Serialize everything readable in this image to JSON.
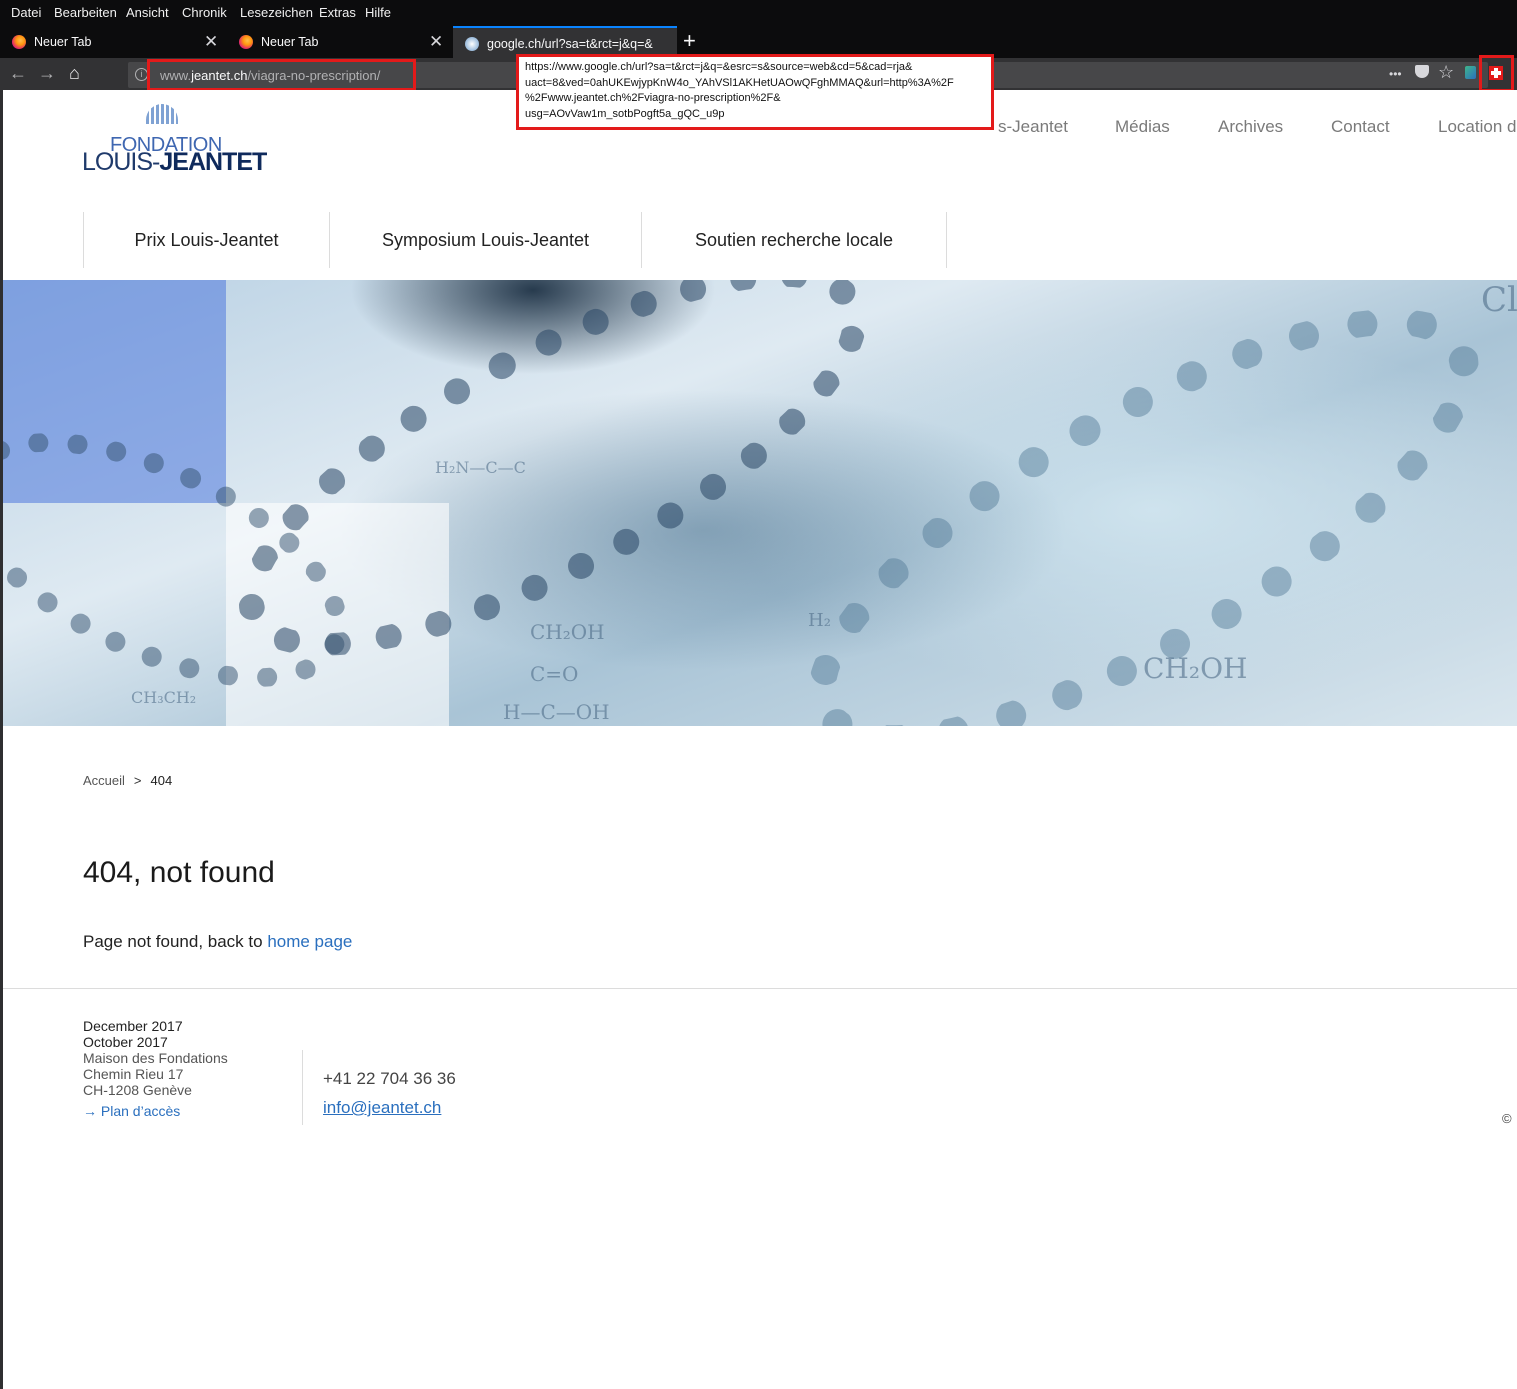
{
  "browser": {
    "menu": [
      "Datei",
      "Bearbeiten",
      "Ansicht",
      "Chronik",
      "Lesezeichen",
      "Extras",
      "Hilfe"
    ],
    "tabs": [
      {
        "title": "Neuer Tab",
        "favicon": "firefox-icon"
      },
      {
        "title": "Neuer Tab",
        "favicon": "firefox-icon"
      },
      {
        "title": "google.ch/url?sa=t&rct=j&q=&",
        "favicon": "globe-icon",
        "active": true
      }
    ],
    "url": {
      "prefix": "www.",
      "domain": "jeantet.ch",
      "path": "/viagra-no-prescription/"
    },
    "tooltip": "https://www.google.ch/url?sa=t&rct=j&q=&esrc=s&source=web&cd=5&cad=rja&\nuact=8&ved=0ahUKEwjypKnW4o_YAhVSl1AKHetUAOwQFghMMAQ&url=http%3A%2F\n%2Fwww.jeantet.ch%2Fviagra-no-prescription%2F&\nusg=AOvVaw1m_sotbPogft5a_gQC_u9p",
    "icons": {
      "more": "•••",
      "pocket": "pocket-icon",
      "star": "☆",
      "extension": "puzzle-icon",
      "swiss_flag": "swiss-flag-icon"
    },
    "accent_color": "#0a84ff",
    "highlight_color": "#e31a1a"
  },
  "site": {
    "logo": {
      "line1": "FONDATION",
      "line2_light": "LOUIS-",
      "line2_bold": "JEANTET"
    },
    "top_nav": [
      "s-Jeantet",
      "Médias",
      "Archives",
      "Contact",
      "Location d"
    ],
    "sub_nav": [
      "Prix Louis-Jeantet",
      "Symposium Louis-Jeantet",
      "Soutien recherche locale"
    ],
    "hero_text": [
      "CH₂OH",
      "H₂N—C—C",
      "CH₂OH",
      "C=O",
      "H—C—OH",
      "CH₃CH₂",
      "Cl",
      "H₂"
    ],
    "breadcrumb": {
      "home": "Accueil",
      "separator": ">",
      "current": "404"
    },
    "heading": "404, not found",
    "message": {
      "text": "Page not found, back to ",
      "link": "home page"
    },
    "footer": {
      "dates": [
        "December 2017",
        "October 2017"
      ],
      "address": [
        "Maison des Fondations",
        "Chemin Rieu 17",
        "CH-1208 Genève"
      ],
      "map_link": "Plan d’accès",
      "phone": "+41 22 704 36 36",
      "email": "info@jeantet.ch",
      "copyright": "©"
    },
    "link_color": "#2a6fbe"
  }
}
